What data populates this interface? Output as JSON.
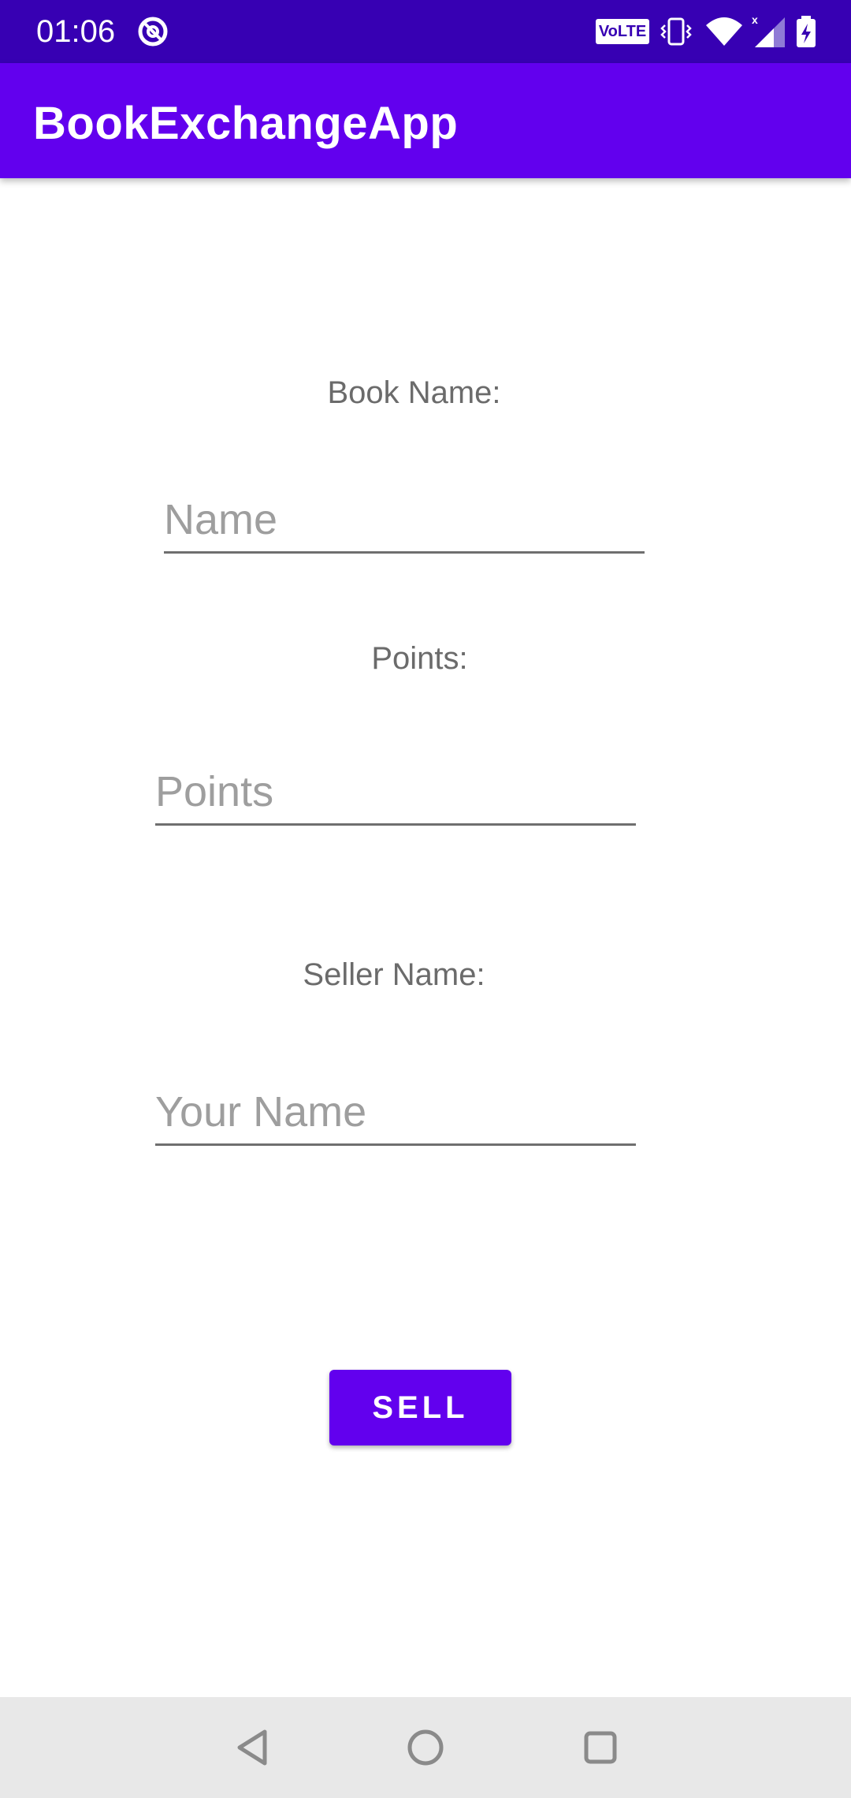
{
  "status_bar": {
    "time": "01:06",
    "volte_label": "VoLTE",
    "icons": [
      "at-sign-icon",
      "volte-icon",
      "vibrate-icon",
      "wifi-icon",
      "signal-icon",
      "battery-charging-icon"
    ]
  },
  "app_bar": {
    "title": "BookExchangeApp",
    "color": "#6200ee"
  },
  "form": {
    "book_name_label": "Book Name:",
    "book_name_placeholder": "Name",
    "book_name_value": "",
    "points_label": "Points:",
    "points_placeholder": "Points",
    "points_value": "",
    "seller_name_label": "Seller Name:",
    "seller_name_placeholder": "Your Name",
    "seller_name_value": ""
  },
  "actions": {
    "sell_label": "SELL"
  },
  "nav_bar": {
    "icons": [
      "back-icon",
      "home-icon",
      "recents-icon"
    ]
  },
  "colors": {
    "status_bar": "#3700b3",
    "accent": "#6200ee",
    "label_text": "#6b6b6b",
    "hint_text": "#9e9e9e"
  }
}
